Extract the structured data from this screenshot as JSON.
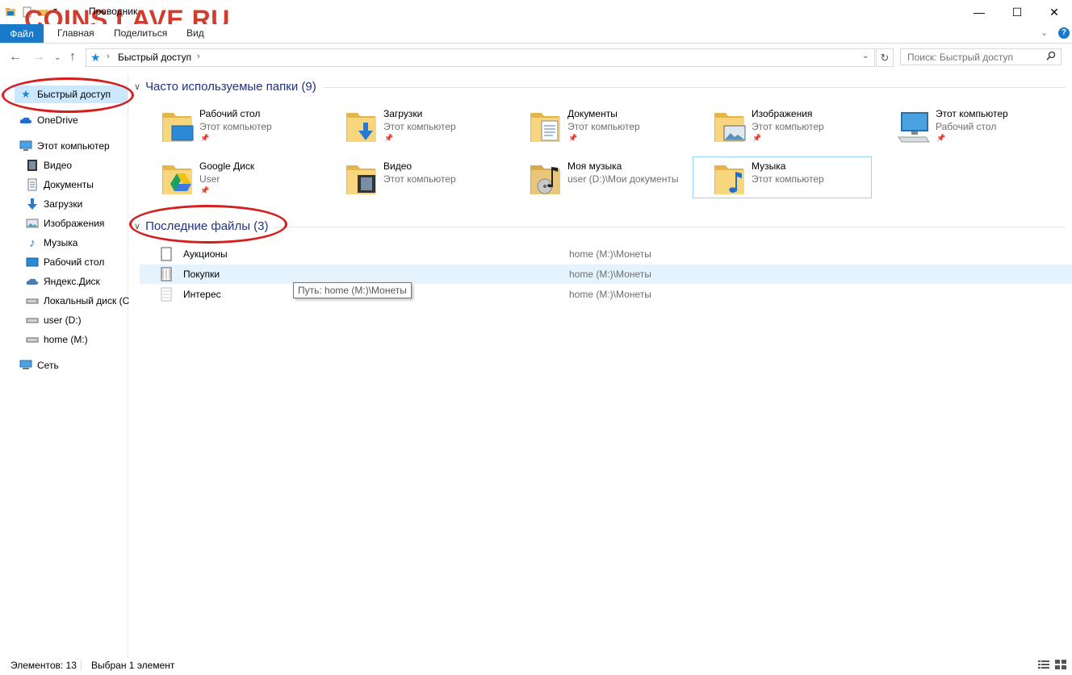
{
  "window": {
    "title": "Проводник",
    "watermark": "COINS.LAVE.RU",
    "controls": {
      "minimize": "—",
      "maximize": "☐",
      "close": "✕"
    }
  },
  "ribbon": {
    "file_tab": "Файл",
    "tabs": [
      "Главная",
      "Поделиться",
      "Вид"
    ],
    "help": "?"
  },
  "navigation": {
    "address_path": "Быстрый доступ",
    "search_placeholder": "Поиск: Быстрый доступ"
  },
  "sidebar": {
    "items": [
      {
        "label": "Быстрый доступ",
        "icon": "star-icon",
        "selected": true
      },
      {
        "label": "OneDrive",
        "icon": "cloud-icon"
      },
      {
        "label": "Этот компьютер",
        "icon": "computer-icon"
      },
      {
        "label": "Видео",
        "icon": "video-icon"
      },
      {
        "label": "Документы",
        "icon": "documents-icon"
      },
      {
        "label": "Загрузки",
        "icon": "download-icon"
      },
      {
        "label": "Изображения",
        "icon": "pictures-icon"
      },
      {
        "label": "Музыка",
        "icon": "music-icon"
      },
      {
        "label": "Рабочий стол",
        "icon": "desktop-icon"
      },
      {
        "label": "Яндекс.Диск",
        "icon": "cloud-icon"
      },
      {
        "label": "Локальный диск (C",
        "icon": "drive-icon"
      },
      {
        "label": "user (D:)",
        "icon": "drive-icon"
      },
      {
        "label": "home (M:)",
        "icon": "drive-icon"
      },
      {
        "label": "Сеть",
        "icon": "network-icon"
      }
    ]
  },
  "frequent": {
    "header": "Часто используемые папки (9)",
    "folders": [
      {
        "name": "Рабочий стол",
        "location": "Этот компьютер",
        "pinned": true,
        "icon": "desktop-folder-icon"
      },
      {
        "name": "Загрузки",
        "location": "Этот компьютер",
        "pinned": true,
        "icon": "downloads-folder-icon"
      },
      {
        "name": "Документы",
        "location": "Этот компьютер",
        "pinned": true,
        "icon": "documents-folder-icon"
      },
      {
        "name": "Изображения",
        "location": "Этот компьютер",
        "pinned": true,
        "icon": "pictures-folder-icon"
      },
      {
        "name": "Этот компьютер",
        "location": "Рабочий стол",
        "pinned": true,
        "icon": "computer-icon"
      },
      {
        "name": "Google Диск",
        "location": "User",
        "pinned": true,
        "icon": "google-drive-folder-icon"
      },
      {
        "name": "Видео",
        "location": "Этот компьютер",
        "pinned": false,
        "icon": "video-folder-icon"
      },
      {
        "name": "Моя музыка",
        "location": "user (D:)\\Мои документы",
        "pinned": false,
        "icon": "music-folder-icon"
      },
      {
        "name": "Музыка",
        "location": "Этот компьютер",
        "pinned": false,
        "icon": "music-folder-icon"
      }
    ]
  },
  "recent": {
    "header": "Последние файлы (3)",
    "files": [
      {
        "name": "Аукционы",
        "path": "home (M:)\\Монеты"
      },
      {
        "name": "Покупки",
        "path": "home (M:)\\Монеты"
      },
      {
        "name": "Интерес",
        "path": "home (M:)\\Монеты"
      }
    ],
    "tooltip": "Путь: home (M:)\\Монеты"
  },
  "status": {
    "count": "Элементов: 13",
    "selection": "Выбран 1 элемент"
  },
  "colors": {
    "accent": "#1979ca",
    "selection": "#cce8ff",
    "group_header": "#1e3287",
    "annotation": "#d51f1f"
  }
}
